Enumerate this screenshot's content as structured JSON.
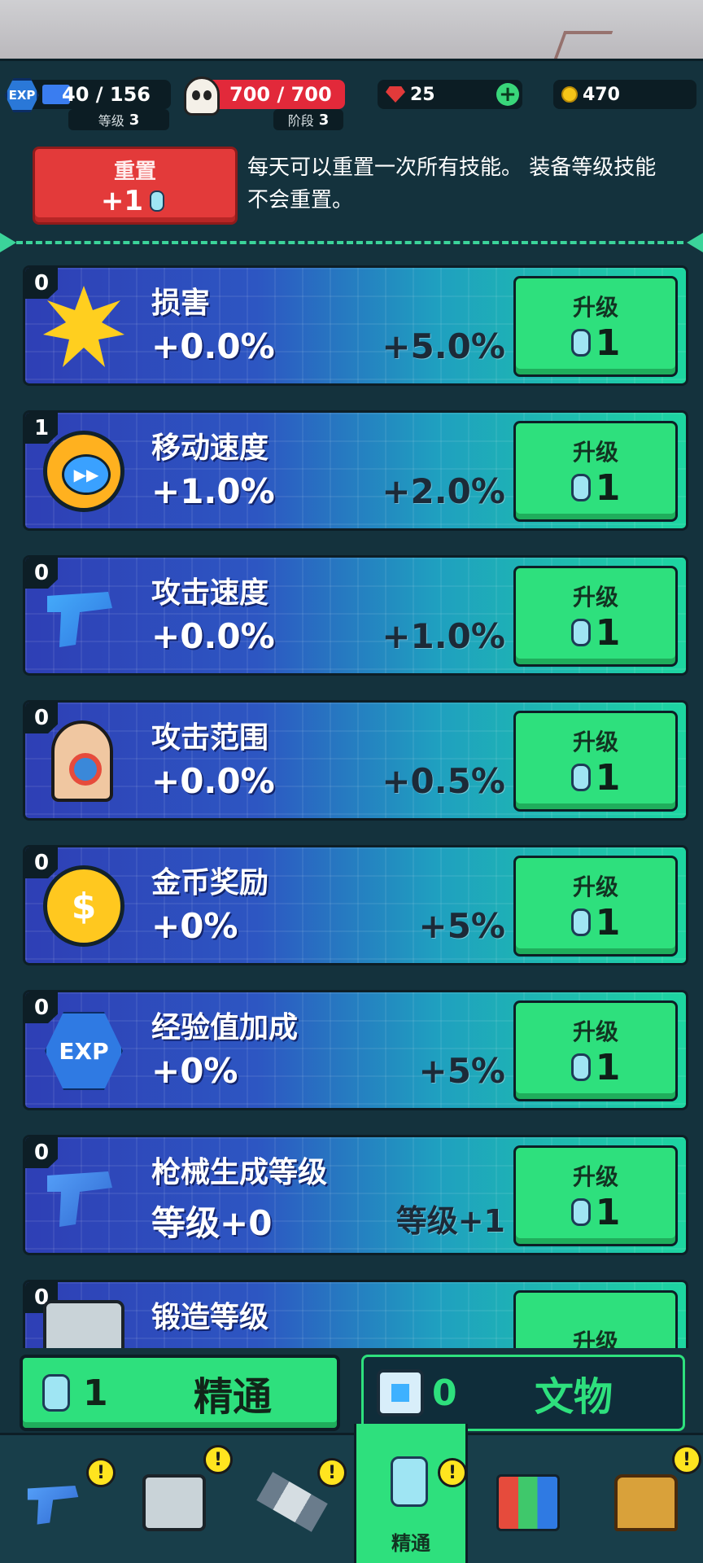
{
  "header": {
    "exp": {
      "icon": "exp-hex-icon",
      "label": "EXP",
      "value": "40 / 156",
      "progress": 0.256,
      "sub_label": "等级",
      "sub_value": "3"
    },
    "health": {
      "icon": "skull-icon",
      "value": "700 / 700",
      "progress": 1.0,
      "sub_label": "阶段",
      "sub_value": "3"
    },
    "gems": {
      "icon": "ruby-icon",
      "value": "25",
      "add_icon": "plus-icon"
    },
    "coins": {
      "icon": "coin-icon",
      "value": "470"
    }
  },
  "reset": {
    "label": "重置",
    "cost": "+1",
    "cost_icon": "dogtag-icon",
    "description": "每天可以重置一次所有技能。 装备等级技能不会重置。"
  },
  "skills": [
    {
      "level": "0",
      "icon": "explosion-icon",
      "name": "损害",
      "current": "+0.0%",
      "next": "+5.0%",
      "upgrade_label": "升级",
      "cost": "1"
    },
    {
      "level": "1",
      "icon": "stopwatch-icon",
      "name": "移动速度",
      "current": "+1.0%",
      "next": "+2.0%",
      "upgrade_label": "升级",
      "cost": "1"
    },
    {
      "level": "0",
      "icon": "dual-pistols-icon",
      "name": "攻击速度",
      "current": "+0.0%",
      "next": "+1.0%",
      "upgrade_label": "升级",
      "cost": "1"
    },
    {
      "level": "0",
      "icon": "target-dummy-icon",
      "name": "攻击范围",
      "current": "+0.0%",
      "next": "+0.5%",
      "upgrade_label": "升级",
      "cost": "1"
    },
    {
      "level": "0",
      "icon": "dollar-coin-icon",
      "name": "金币奖励",
      "current": "+0%",
      "next": "+5%",
      "upgrade_label": "升级",
      "cost": "1"
    },
    {
      "level": "0",
      "icon": "exp-badge-icon",
      "name": "经验值加成",
      "current": "+0%",
      "next": "+5%",
      "upgrade_label": "升级",
      "cost": "1"
    },
    {
      "level": "0",
      "icon": "pistol-icon",
      "name": "枪械生成等级",
      "current": "等级+0",
      "next": "等级+1",
      "upgrade_label": "升级",
      "cost": "1"
    },
    {
      "level": "0",
      "icon": "toolbox-icon",
      "name": "锻造等级",
      "current": "",
      "next": "",
      "upgrade_label": "升级",
      "cost": ""
    }
  ],
  "bottom_tabs": {
    "mastery": {
      "icon": "dogtag-icon",
      "count": "1",
      "label": "精通"
    },
    "relic": {
      "icon": "chip-icon",
      "count": "0",
      "label": "文物"
    }
  },
  "nav": [
    {
      "icon": "pistol-icon",
      "alert": "!"
    },
    {
      "icon": "toolbox-icon",
      "alert": "!"
    },
    {
      "icon": "satellite-icon",
      "alert": "!"
    },
    {
      "icon": "dogtag-icon",
      "alert": "!",
      "label": "精通",
      "active": true
    },
    {
      "icon": "cards-icon"
    },
    {
      "icon": "treasure-chest-icon",
      "alert": "!"
    }
  ],
  "colors": {
    "accent_green": "#2ee07d",
    "reset_red": "#e33a3a",
    "panel_dark": "#14323d"
  }
}
